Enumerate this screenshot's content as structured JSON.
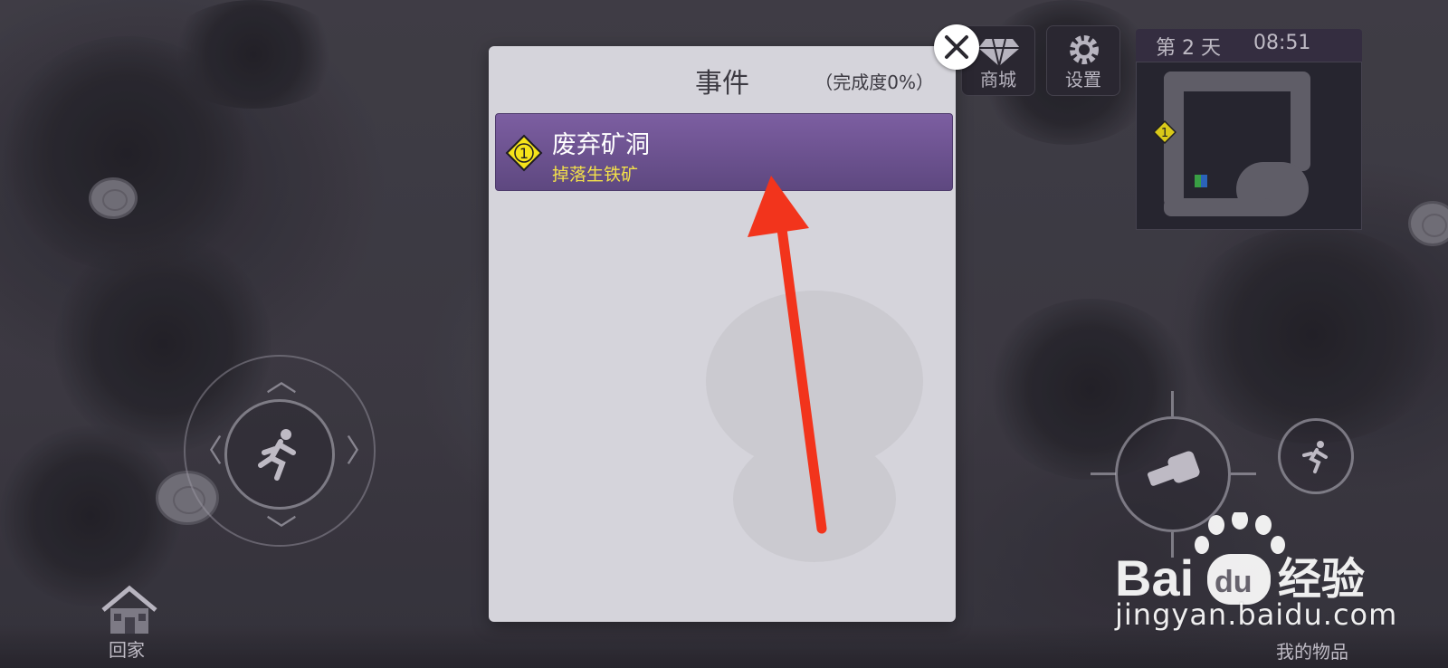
{
  "hud": {
    "shop_label": "商城",
    "settings_label": "设置",
    "day_text": "第 2 天",
    "time_text": "08:51",
    "minimap_event_number": "1"
  },
  "modal": {
    "title": "事件",
    "progress": "（完成度0%）",
    "events": [
      {
        "number": "1",
        "name": "废弃矿洞",
        "drop": "掉落生铁矿"
      }
    ]
  },
  "bottom": {
    "home_label": "回家",
    "inventory_label": "我的物品"
  },
  "watermark": {
    "logo_text": "Bai du 经验",
    "url": "jingyan.baidu.com"
  },
  "colors": {
    "event_bg": "#6b5290",
    "event_drop_text": "#f3e04a",
    "badge_yellow": "#f5e31a",
    "annotation_red": "#f2341c"
  }
}
